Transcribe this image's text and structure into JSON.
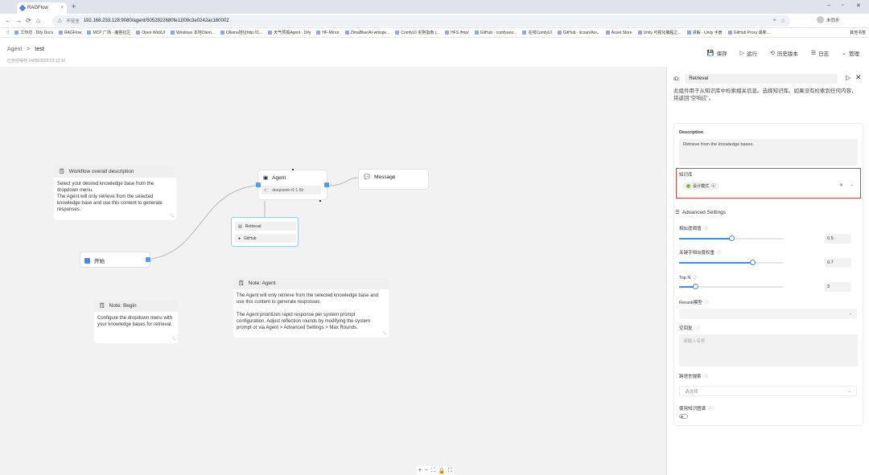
{
  "browser": {
    "tab_title": "RAGFlow",
    "tab_close": "×",
    "new_tab": "+",
    "window_controls": [
      "–",
      "▫",
      "✕"
    ],
    "insecure_label": "不安全",
    "url": "192.168.233.128:9080/agent/5052922680fe11f09c3e0242ac160002",
    "profile_label": "未同步",
    "nav": [
      "←",
      "→",
      "⟳",
      "⌂"
    ],
    "bookmarks": [
      "工作坊 · Dify Docs",
      "RAGFlow",
      "MCP 广场 · 魔搭社区",
      "Open WebUI",
      "Windows 本地Olam...",
      "Ollama地址http://1...",
      "天气预报Agent · Dify",
      "HF-Mirror",
      "ZimaBlue/AI-whispe...",
      "ComfyUI 实例指南 |...",
      "HFS /fmp/",
      "GitHub · comfyano...",
      "在线ComfyUI",
      "GitHub · licoan/Ani...",
      "Asset Store",
      "Unity 可视化编程之...",
      "讲解 · Unity 手册",
      "GitHub Proxy 最新..."
    ],
    "bookmarks_right": "其他书签"
  },
  "header": {
    "breadcrumb_root": "Agent",
    "breadcrumb_sep": ">",
    "breadcrumb_current": "test",
    "saved_text": "已自动保存 24/08/2025 23:12:10",
    "actions": [
      "保存",
      "运行",
      "历史版本",
      "日志",
      "管理"
    ],
    "action_icons": [
      "💾",
      "▷",
      "⟲",
      "☰",
      "⌄"
    ]
  },
  "canvas": {
    "note_workflow": {
      "title": "Workflow overall description",
      "body": "Select your desired knowledge base from the dropdown menu.\nThe Agent will only retrieve from the selected knowledge base and use this content  to generate responses."
    },
    "note_begin": {
      "title": "Note: Begin",
      "body": "Configure the dropdown menu with your knowledge bases for retrieval."
    },
    "note_agent": {
      "title": "Note: Agent",
      "body": "The Agent will only retrieve from the selected knowledge base and use this content  to generate responses.\n\nThe Agent prioritizes rapid response per system prompt configuration. Adjust reflection rounds by modifying the system prompt or via Agent > Advanced Settings > Max Rounds."
    },
    "node_begin": "开始",
    "node_agent": "Agent",
    "agent_model": "deepseek-r1:1.5b",
    "node_message": "Message",
    "tools": [
      "Retrieval",
      "GitHub"
    ],
    "zoom_controls": [
      "+",
      "−",
      "⛶",
      "🔒",
      "⛶"
    ]
  },
  "panel": {
    "id_label": "ID:",
    "id_value": "Retrieval",
    "description_text": "此组件用于从知识库中检索相关信息。选择知识库。如果没有检索到任何内容，将返回\"空响应\"。",
    "desc_label": "Description",
    "desc_value": "Retrieve from the knowledge bases.",
    "kb_label": "知识库",
    "kb_tag": "设计模式",
    "adv_label": "Advanced Settings",
    "similarity_label": "相似度阈值",
    "similarity_value": "0.5",
    "similarity_fraction": 0.5,
    "keyword_label": "关键字相似度权重",
    "keyword_value": "0.7",
    "keyword_fraction": 0.7,
    "topn_label": "Top N",
    "topn_value": "3",
    "topn_fraction": 0.15,
    "rerank_label": "Rerank模型",
    "empty_label": "空回复",
    "empty_placeholder": "请输入名称",
    "crosslang_label": "跨语言搜索",
    "crosslang_placeholder": "请选择",
    "kg_label": "使用知识图谱",
    "accent_color": "#3d8bf2",
    "highlight_color": "#d64545"
  }
}
